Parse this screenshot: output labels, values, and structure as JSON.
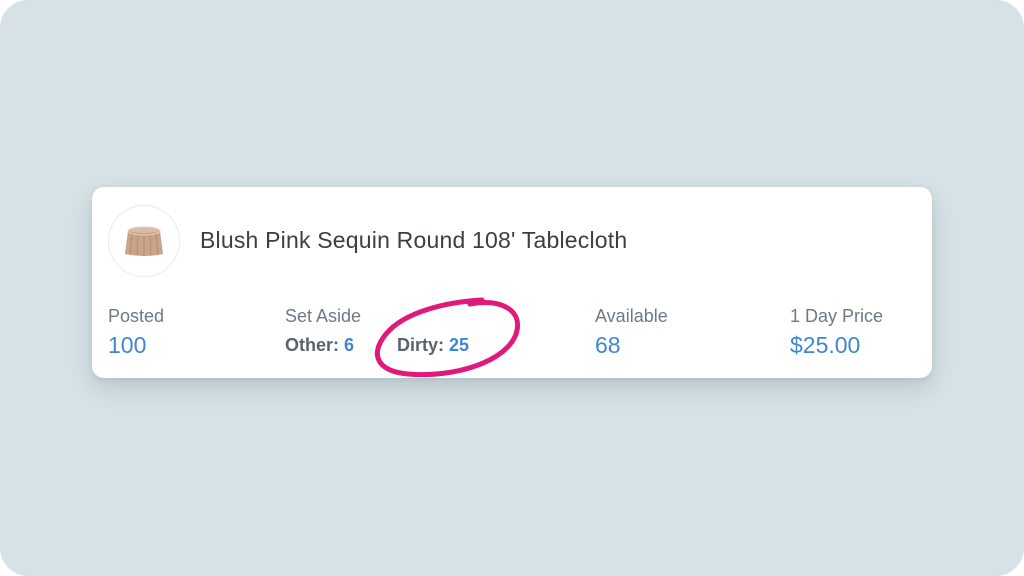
{
  "item": {
    "name": "Blush Pink Sequin Round 108' Tablecloth",
    "thumbnail_icon": "tablecloth-thumbnail"
  },
  "stats": {
    "posted": {
      "label": "Posted",
      "value": "100"
    },
    "set_aside": {
      "label": "Set Aside",
      "other_label": "Other:",
      "other_value": "6",
      "dirty_label": "Dirty:",
      "dirty_value": "25"
    },
    "available": {
      "label": "Available",
      "value": "68"
    },
    "day_price": {
      "label": "1 Day Price",
      "value": "$25.00"
    }
  },
  "colors": {
    "background": "#d6e2e6",
    "value_blue": "#3f86d6",
    "highlight_circle": "#e0197a"
  }
}
